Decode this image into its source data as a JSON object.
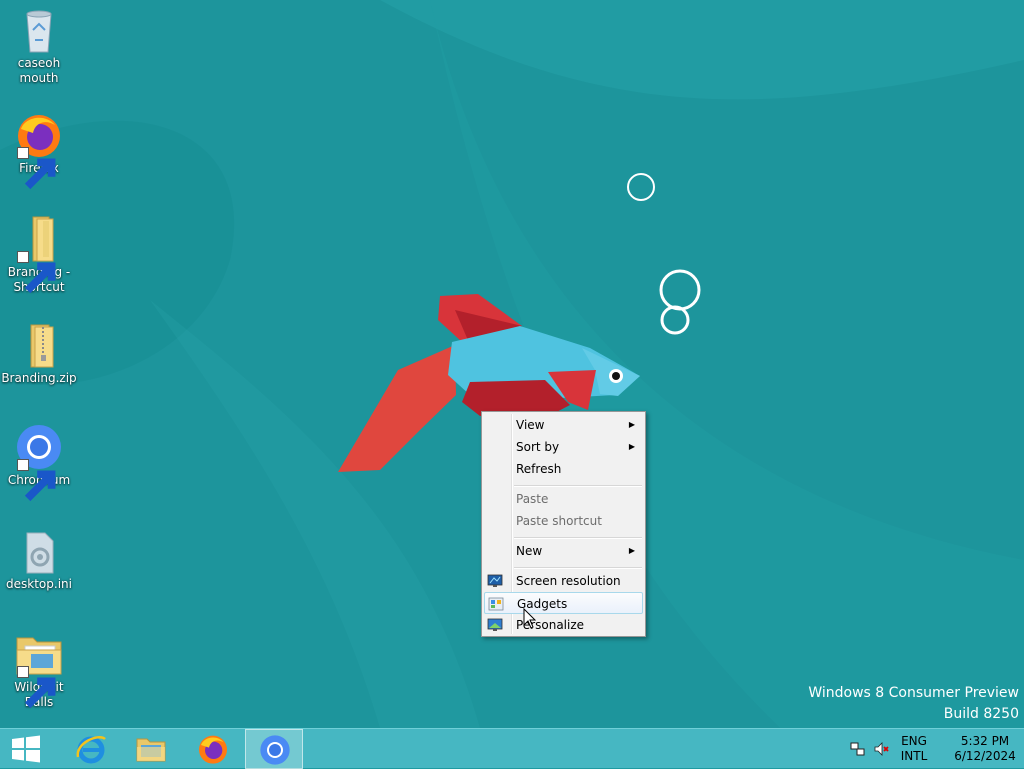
{
  "desktop_icons": [
    {
      "label": "caseoh mouth",
      "icon": "recycle-bin-icon",
      "shortcut": false
    },
    {
      "label": "Firefox",
      "icon": "firefox-icon",
      "shortcut": true
    },
    {
      "label": "Branding - Shortcut",
      "icon": "folder-icon",
      "shortcut": true
    },
    {
      "label": "Branding.zip",
      "icon": "zip-folder-icon",
      "shortcut": false
    },
    {
      "label": "Chromium",
      "icon": "chromium-icon",
      "shortcut": true
    },
    {
      "label": "desktop.ini",
      "icon": "settings-file-icon",
      "shortcut": false
    },
    {
      "label": "WildShit Balls",
      "icon": "folder-icon",
      "shortcut": true
    }
  ],
  "watermark": {
    "line1": "Windows 8 Consumer Preview",
    "line2": "Build 8250"
  },
  "context_menu": {
    "items": [
      {
        "label": "View",
        "submenu": true,
        "enabled": true
      },
      {
        "label": "Sort by",
        "submenu": true,
        "enabled": true
      },
      {
        "label": "Refresh",
        "submenu": false,
        "enabled": true
      },
      {
        "label": "Paste",
        "submenu": false,
        "enabled": false
      },
      {
        "label": "Paste shortcut",
        "submenu": false,
        "enabled": false
      },
      {
        "label": "New",
        "submenu": true,
        "enabled": true
      },
      {
        "label": "Screen resolution",
        "icon": "screen-resolution-icon",
        "enabled": true
      },
      {
        "label": "Gadgets",
        "icon": "gadgets-icon",
        "enabled": true,
        "hovered": true
      },
      {
        "label": "Personalize",
        "icon": "personalize-icon",
        "enabled": true
      }
    ]
  },
  "taskbar": {
    "buttons": [
      {
        "name": "start-button",
        "icon": "windows-logo-icon"
      },
      {
        "name": "internet-explorer",
        "icon": "internet-explorer-icon"
      },
      {
        "name": "file-explorer",
        "icon": "file-explorer-icon"
      },
      {
        "name": "firefox",
        "icon": "firefox-icon"
      },
      {
        "name": "chromium",
        "icon": "chromium-icon",
        "active": true
      }
    ],
    "tray": {
      "language": "ENG",
      "layout": "INTL",
      "time": "5:32 PM",
      "date": "6/12/2024"
    }
  },
  "colors": {
    "wallpaper": "#1f9aa1",
    "taskbar": "#4abac4",
    "menu_bg": "#f1f1f1",
    "menu_hover_border": "#a8d8eb"
  }
}
